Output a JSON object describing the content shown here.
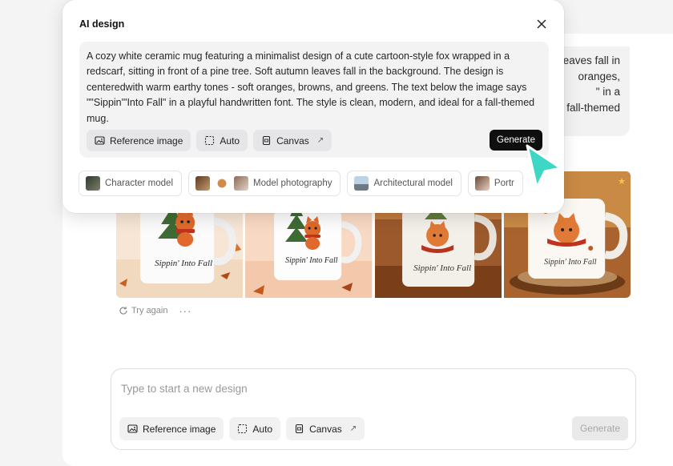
{
  "background": {
    "bubble_lines": [
      "autumn leaves fall in",
      "oranges,",
      "\" in a",
      "fall-themed"
    ],
    "actions": {
      "retry_label": "Try again",
      "more_label": "···"
    },
    "images": [
      {
        "alt_text": "Sippin' Into Fall"
      },
      {
        "alt_text": "Sippin' Into Fall"
      },
      {
        "alt_text": "Sippin' Into Fall"
      },
      {
        "alt_text": "Sippin' Into Fall"
      }
    ]
  },
  "composer": {
    "placeholder": "Type to start a new design",
    "reference_label": "Reference image",
    "auto_label": "Auto",
    "canvas_label": "Canvas",
    "generate_label": "Generate"
  },
  "popup": {
    "title": "AI design",
    "prompt": "A cozy white ceramic mug featuring a minimalist design of a cute cartoon-style fox wrapped in a redscarf, sitting in front of a pine tree. Soft autumn leaves fall in the background. The design is centeredwith warm earthy tones - soft oranges, browns, and greens. The text below the image says \"\"Sippin'\"Into Fall\" in a playful handwritten font. The style is clean, modern, and ideal for a fall-themed mug.",
    "reference_label": "Reference image",
    "auto_label": "Auto",
    "canvas_label": "Canvas",
    "generate_label": "Generate",
    "chips": [
      {
        "label": "Character model"
      },
      {
        "label": "Model photography"
      },
      {
        "label": "Architectural model"
      },
      {
        "label": "Portr"
      }
    ]
  },
  "colors": {
    "accent_cursor": "#3ed6c4",
    "generate_bg": "#0f0f0f",
    "mug_orange": "#d9642a",
    "pine_green": "#3f6b34"
  },
  "icons": {
    "close": "close-icon",
    "image": "image-icon",
    "auto": "dashed-square-icon",
    "canvas": "canvas-icon",
    "arrow": "arrow-up-right-icon",
    "retry": "refresh-icon",
    "cursor": "pointer-cursor-icon"
  }
}
